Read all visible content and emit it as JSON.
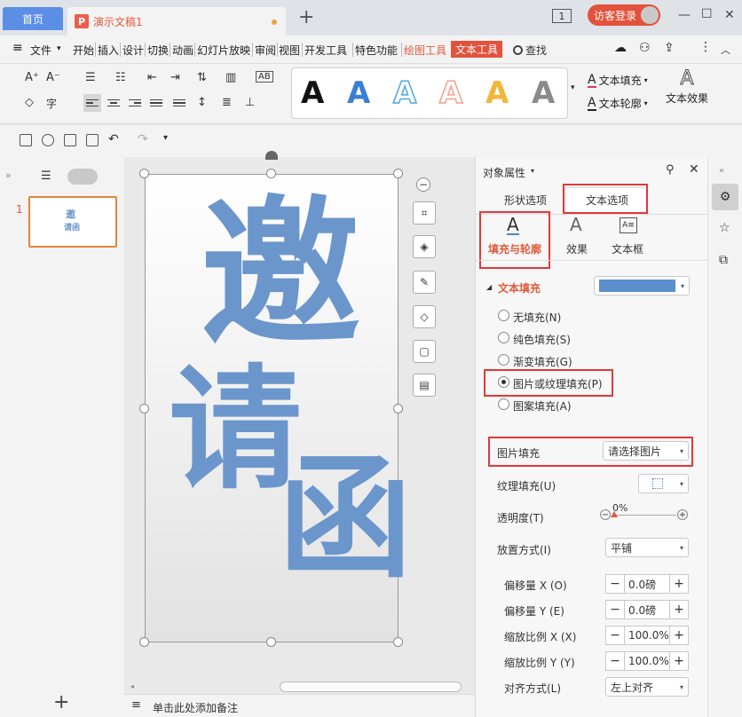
{
  "tabs": {
    "home": "首页",
    "doc_icon": "P",
    "doc": "演示文稿1",
    "new_tab": "+"
  },
  "window": {
    "count": "1",
    "login": "访客登录"
  },
  "menu": {
    "hamburger": "≡",
    "file": "文件",
    "items": [
      "开始",
      "插入",
      "设计",
      "切换",
      "动画",
      "幻灯片放映",
      "审阅",
      "视图",
      "开发工具",
      "特色功能"
    ],
    "drawing_tools": "绘图工具",
    "text_tools": "文本工具",
    "search": "查找"
  },
  "ribbon": {
    "text_fill": "文本填充",
    "text_outline": "文本轮廓",
    "text_effect": "文本效果",
    "style_letter": "A",
    "style_colors": [
      "#111111",
      "#3a7fd5",
      "#4aa7e0",
      "#f0a090",
      "#f5b53a",
      "#8a8a8a"
    ]
  },
  "slide": {
    "number": "1",
    "chars": [
      "邀",
      "请",
      "函"
    ],
    "thumb_chars": [
      "邀",
      "请函"
    ],
    "text_color": "#6b96cc",
    "notes_placeholder": "单击此处添加备注"
  },
  "panel": {
    "title": "对象属性",
    "tab_shape": "形状选项",
    "tab_text": "文本选项",
    "sub_fill_outline": "填充与轮廓",
    "sub_effect": "效果",
    "sub_textbox": "文本框",
    "section_text_fill": "文本填充",
    "fill_color": "#5b8fcc",
    "radios": [
      {
        "label": "无填充(N)",
        "checked": false
      },
      {
        "label": "纯色填充(S)",
        "checked": false
      },
      {
        "label": "渐变填充(G)",
        "checked": false
      },
      {
        "label": "图片或纹理填充(P)",
        "checked": true
      },
      {
        "label": "图案填充(A)",
        "checked": false
      }
    ],
    "picture_fill_label": "图片填充",
    "picture_fill_value": "请选择图片",
    "texture_fill_label": "纹理填充(U)",
    "transparency_label": "透明度(T)",
    "transparency_value": "0%",
    "placement_label": "放置方式(I)",
    "placement_value": "平铺",
    "offset_x_label": "偏移量 X (O)",
    "offset_x_value": "0.0磅",
    "offset_y_label": "偏移量 Y (E)",
    "offset_y_value": "0.0磅",
    "scale_x_label": "缩放比例 X (X)",
    "scale_x_value": "100.0%",
    "scale_y_label": "缩放比例 Y (Y)",
    "scale_y_value": "100.0%",
    "align_label": "对齐方式(L)",
    "align_value": "左上对齐"
  }
}
